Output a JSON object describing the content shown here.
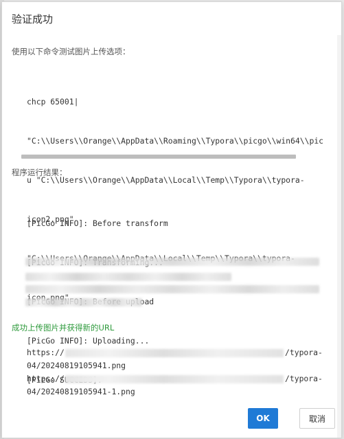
{
  "dialog": {
    "title": "验证成功",
    "command_label": "使用以下命令测试图片上传选项：",
    "command_lines": [
      "chcp 65001|",
      "\"C:\\\\Users\\\\Orange\\\\AppData\\\\Roaming\\\\Typora\\\\picgo\\\\win64\\\\pic",
      "u \"C:\\\\Users\\\\Orange\\\\AppData\\\\Local\\\\Temp\\\\Typora\\\\typora-",
      "icon2.png\"",
      "\"C:\\\\Users\\\\Orange\\\\AppData\\\\Local\\\\Temp\\\\Typora\\\\typora-",
      "icon.png\""
    ],
    "result_label": "程序运行结果：",
    "result_lines": [
      "[PicGo INFO]: Before transform",
      "[PicGo INFO]: Transforming...",
      "[PicGo INFO]: Before upload",
      "[PicGo INFO]: Uploading...",
      "[PicGo SUCCESS]:"
    ],
    "success_label": "成功上传图片并获得新的URL",
    "urls": [
      {
        "prefix": "https://",
        "suffix": "/typora-",
        "continuation": "04/20240819105941.png"
      },
      {
        "prefix": "https://",
        "suffix": "/typora-",
        "continuation": "04/20240819105941-1.png"
      }
    ],
    "ok_label": "OK",
    "cancel_label": "取消"
  },
  "colors": {
    "accent": "#1f7ad6",
    "success_text": "#2e9a3c"
  }
}
